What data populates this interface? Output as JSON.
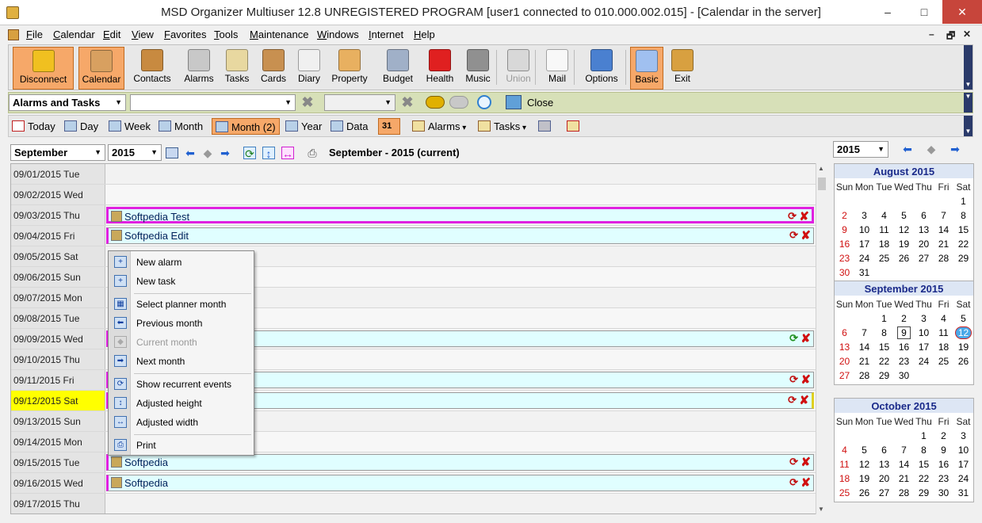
{
  "window": {
    "title": "MSD Organizer Multiuser 12.8 UNREGISTERED PROGRAM [user1 connected to 010.000.002.015] - [Calendar in the server]",
    "minimize": "–",
    "maximize": "□",
    "close": "✕"
  },
  "menu": {
    "items": [
      "File",
      "Calendar",
      "Edit",
      "View",
      "Favorites",
      "Tools",
      "Maintenance",
      "Windows",
      "Internet",
      "Help"
    ],
    "mdi_controls": [
      "–",
      "🗗",
      "✕"
    ]
  },
  "toolbar": {
    "buttons": [
      {
        "label": "Disconnect",
        "icon": "plug-lightning-icon",
        "color": "#f0c020",
        "active": true
      },
      {
        "label": "Calendar",
        "icon": "calendar-31-icon",
        "color": "#d8a060",
        "active": true
      },
      {
        "label": "Contacts",
        "icon": "address-book-icon",
        "color": "#c88a40"
      },
      {
        "label": "Alarms",
        "icon": "alarm-clock-icon",
        "color": "#c8c8c8"
      },
      {
        "label": "Tasks",
        "icon": "task-clipboard-icon",
        "color": "#e8d8a0"
      },
      {
        "label": "Cards",
        "icon": "card-stack-icon",
        "color": "#c89050"
      },
      {
        "label": "Diary",
        "icon": "diary-pen-icon",
        "color": "#f0f0f0"
      },
      {
        "label": "Property",
        "icon": "house-icon",
        "color": "#e8b060"
      },
      {
        "label": "Budget",
        "icon": "calculator-icon",
        "color": "#a0b0c8"
      },
      {
        "label": "Health",
        "icon": "red-cross-icon",
        "color": "#e02020"
      },
      {
        "label": "Music",
        "icon": "music-disc-icon",
        "color": "#909090"
      },
      {
        "label": "Union",
        "icon": "union-gear-icon",
        "color": "#d8d8d8",
        "disabled": true
      },
      {
        "label": "Mail",
        "icon": "envelope-icon",
        "color": "#f8f8f8"
      },
      {
        "label": "Options",
        "icon": "options-gear-icon",
        "color": "#4a80d0"
      },
      {
        "label": "Basic",
        "icon": "basic-window-icon",
        "color": "#a0c0f0",
        "active": true
      },
      {
        "label": "Exit",
        "icon": "exit-door-icon",
        "color": "#d8a040"
      }
    ]
  },
  "alarmbar": {
    "category": "Alarms and Tasks",
    "close_label": "Close"
  },
  "viewbar": {
    "buttons": [
      {
        "label": "Today",
        "icon": "today-1-icon"
      },
      {
        "label": "Day",
        "icon": "day-view-icon"
      },
      {
        "label": "Week",
        "icon": "week-view-icon"
      },
      {
        "label": "Month",
        "icon": "month-view-icon"
      },
      {
        "label": "Month (2)",
        "icon": "month2-view-icon",
        "active": true
      },
      {
        "label": "Year",
        "icon": "year-view-icon"
      },
      {
        "label": "Data",
        "icon": "data-grid-icon"
      }
    ],
    "menus": [
      {
        "label": "Alarms",
        "icon": "alarm-clock-small-icon"
      },
      {
        "label": "Tasks",
        "icon": "task-small-icon"
      }
    ],
    "day31": "31"
  },
  "nav": {
    "month": "September",
    "year": "2015",
    "label": "September - 2015 (current)"
  },
  "days": [
    {
      "date": "09/01/2015 Tue"
    },
    {
      "date": "09/02/2015 Wed"
    },
    {
      "date": "09/03/2015 Thu",
      "event": "Softpedia Test",
      "style": "hl"
    },
    {
      "date": "09/04/2015 Fri",
      "event": "Softpedia Edit"
    },
    {
      "date": "09/05/2015 Sat"
    },
    {
      "date": "09/06/2015 Sun"
    },
    {
      "date": "09/07/2015 Mon"
    },
    {
      "date": "09/08/2015 Tue"
    },
    {
      "date": "09/09/2015 Wed",
      "event": ""
    },
    {
      "date": "09/10/2015 Thu"
    },
    {
      "date": "09/11/2015 Fri",
      "event": ""
    },
    {
      "date": "09/12/2015 Sat",
      "event": "",
      "today": true,
      "style": "yl"
    },
    {
      "date": "09/13/2015 Sun"
    },
    {
      "date": "09/14/2015 Mon"
    },
    {
      "date": "09/15/2015 Tue",
      "event": "Softpedia"
    },
    {
      "date": "09/16/2015 Wed",
      "event": "Softpedia"
    },
    {
      "date": "09/17/2015 Thu"
    }
  ],
  "context_menu": [
    {
      "label": "New alarm",
      "icon": "new-alarm-icon"
    },
    {
      "label": "New task",
      "icon": "new-task-icon",
      "sep_after": true
    },
    {
      "label": "Select planner month",
      "icon": "planner-month-icon"
    },
    {
      "label": "Previous month",
      "icon": "arrow-left-icon"
    },
    {
      "label": "Current month",
      "icon": "current-month-icon",
      "disabled": true
    },
    {
      "label": "Next month",
      "icon": "arrow-right-icon",
      "sep_after": true
    },
    {
      "label": "Show recurrent events",
      "icon": "recurrent-icon"
    },
    {
      "label": "Adjusted height",
      "icon": "adjust-height-icon"
    },
    {
      "label": "Adjusted width",
      "icon": "adjust-width-icon",
      "sep_after": true
    },
    {
      "label": "Print",
      "icon": "printer-icon"
    }
  ],
  "mini": {
    "year": "2015",
    "weekdays": [
      "Sun",
      "Mon",
      "Tue",
      "Wed",
      "Thu",
      "Fri",
      "Sat"
    ],
    "months": [
      {
        "title": "August 2015",
        "start": 6,
        "days": 31
      },
      {
        "title": "September 2015",
        "start": 2,
        "days": 30,
        "boxed": 9,
        "today": 12
      },
      {
        "title": "October 2015",
        "start": 4,
        "days": 31
      }
    ]
  },
  "colors": {
    "accent": "#f6a869",
    "event_border": "#e020e0",
    "event_bg": "#e0feff",
    "today": "#ffff00",
    "sunday_red": "#d01010",
    "month_title": "#1a2a8a"
  }
}
